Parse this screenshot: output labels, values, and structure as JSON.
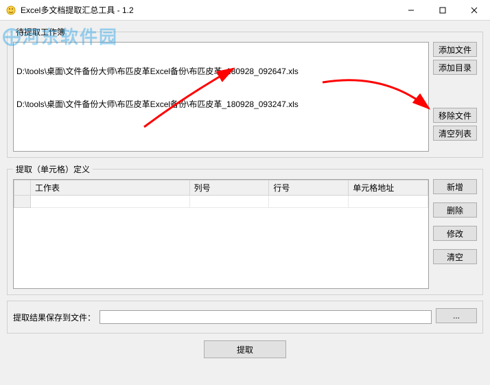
{
  "window": {
    "title": "Excel多文档提取汇总工具 - 1.2"
  },
  "workbook_group": {
    "legend": "待提取工作簿",
    "files": [
      "D:\\tools\\桌面\\文件备份大师\\布匹皮革Excel备份\\布匹皮革_180928_092647.xls",
      "D:\\tools\\桌面\\文件备份大师\\布匹皮革Excel备份\\布匹皮革_180928_093247.xls"
    ],
    "buttons": {
      "add_file": "添加文件",
      "add_dir": "添加目录",
      "remove_file": "移除文件",
      "clear_list": "清空列表"
    }
  },
  "cell_def_group": {
    "legend": "提取（单元格）定义",
    "headers": {
      "sheet": "工作表",
      "col": "列号",
      "row": "行号",
      "addr": "单元格地址"
    },
    "buttons": {
      "add": "新增",
      "del": "删除",
      "edit": "修改",
      "clear": "清空"
    }
  },
  "save": {
    "label": "提取结果保存到文件：",
    "value": "",
    "browse": "..."
  },
  "extract_button": "提取",
  "watermark": "河东软件园"
}
